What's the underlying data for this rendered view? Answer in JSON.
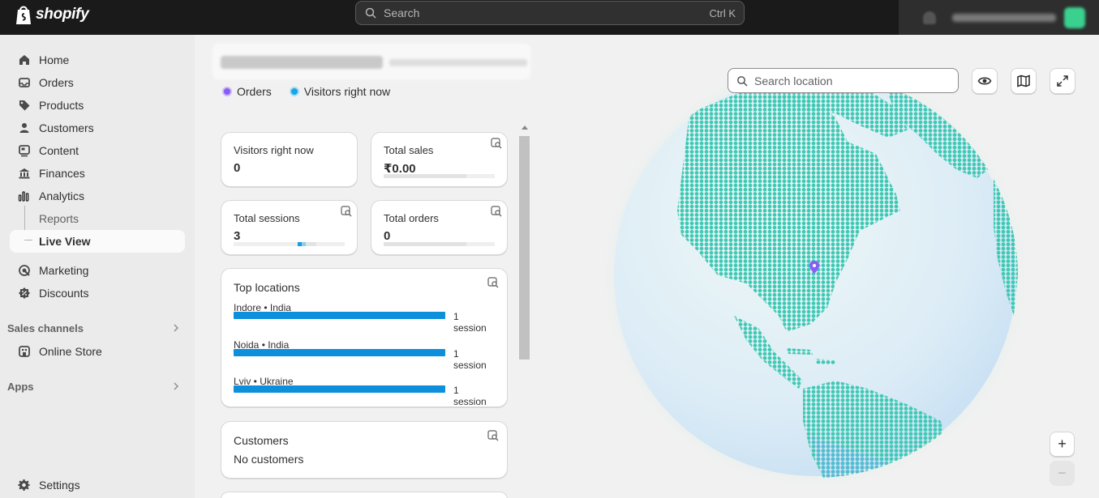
{
  "topbar": {
    "brand": "shopify",
    "search_placeholder": "Search",
    "search_shortcut": "Ctrl K"
  },
  "sidebar": {
    "items": [
      {
        "label": "Home",
        "icon": "home-icon"
      },
      {
        "label": "Orders",
        "icon": "inbox-icon"
      },
      {
        "label": "Products",
        "icon": "tag-icon"
      },
      {
        "label": "Customers",
        "icon": "person-icon"
      },
      {
        "label": "Content",
        "icon": "content-icon"
      },
      {
        "label": "Finances",
        "icon": "bank-icon"
      },
      {
        "label": "Analytics",
        "icon": "bar-chart-icon"
      }
    ],
    "analytics_sub": [
      {
        "label": "Reports"
      },
      {
        "label": "Live View",
        "active": true
      }
    ],
    "items2": [
      {
        "label": "Marketing",
        "icon": "target-icon"
      },
      {
        "label": "Discounts",
        "icon": "discount-icon"
      }
    ],
    "sales_channels_title": "Sales channels",
    "online_store": "Online Store",
    "apps_title": "Apps",
    "settings": "Settings"
  },
  "main": {
    "legend": [
      {
        "label": "Orders",
        "color": "#8a5cf6"
      },
      {
        "label": "Visitors right now",
        "color": "#17a5e6"
      }
    ],
    "metrics": {
      "visitors_label": "Visitors right now",
      "visitors_value": "0",
      "sales_label": "Total sales",
      "sales_value": "₹0.00",
      "sessions_label": "Total sessions",
      "sessions_value": "3",
      "orders_label": "Total orders",
      "orders_value": "0"
    },
    "top_locations": {
      "title": "Top locations",
      "rows": [
        {
          "name": "Indore • India",
          "count": "1 session"
        },
        {
          "name": "Noida • India",
          "count": "1 session"
        },
        {
          "name": "Lviv • Ukraine",
          "count": "1 session"
        }
      ]
    },
    "customers": {
      "title": "Customers",
      "empty": "No customers"
    }
  },
  "map": {
    "search_placeholder": "Search location",
    "buttons": [
      "eye-icon",
      "map-icon",
      "expand-icon"
    ],
    "zoom_in": "+",
    "zoom_out": "−",
    "land_color": "#3ec9b4",
    "ocean_color": "#dcecf6"
  }
}
